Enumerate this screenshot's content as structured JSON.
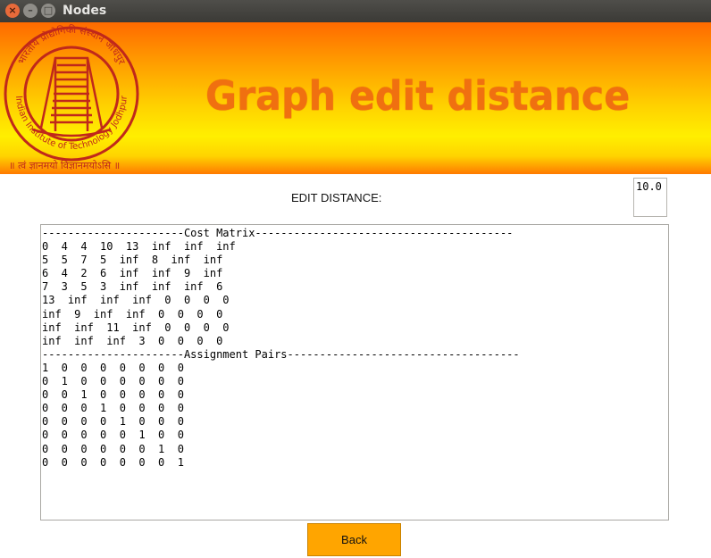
{
  "window": {
    "title": "Nodes",
    "close_glyph": "×",
    "min_glyph": "–",
    "max_glyph": "□"
  },
  "banner": {
    "title": "Graph edit distance",
    "logo": {
      "arc_text": "Indian Institute of Technology Jodhpur",
      "motto": "॥ त्वं ज्ञानमयो विज्ञानमयोऽसि ॥",
      "hindi_text": "भारतीय प्रौद्योगिकी संस्थान जोधपुर"
    },
    "colors": {
      "title": "#f07010",
      "logo": "#c0281b"
    }
  },
  "edit_distance": {
    "label": "EDIT DISTANCE:",
    "value": "10.0"
  },
  "output": {
    "lines": [
      "----------------------Cost Matrix----------------------------------------",
      "0  4  4  10  13  inf  inf  inf",
      "5  5  7  5  inf  8  inf  inf",
      "6  4  2  6  inf  inf  9  inf",
      "7  3  5  3  inf  inf  inf  6",
      "13  inf  inf  inf  0  0  0  0",
      "inf  9  inf  inf  0  0  0  0",
      "inf  inf  11  inf  0  0  0  0",
      "inf  inf  inf  3  0  0  0  0",
      "----------------------Assignment Pairs------------------------------------",
      "1  0  0  0  0  0  0  0",
      "0  1  0  0  0  0  0  0",
      "0  0  1  0  0  0  0  0",
      "0  0  0  1  0  0  0  0",
      "0  0  0  0  1  0  0  0",
      "0  0  0  0  0  1  0  0",
      "0  0  0  0  0  0  1  0",
      "0  0  0  0  0  0  0  1"
    ]
  },
  "back_button": {
    "label": "Back",
    "color": "#ffa500"
  }
}
